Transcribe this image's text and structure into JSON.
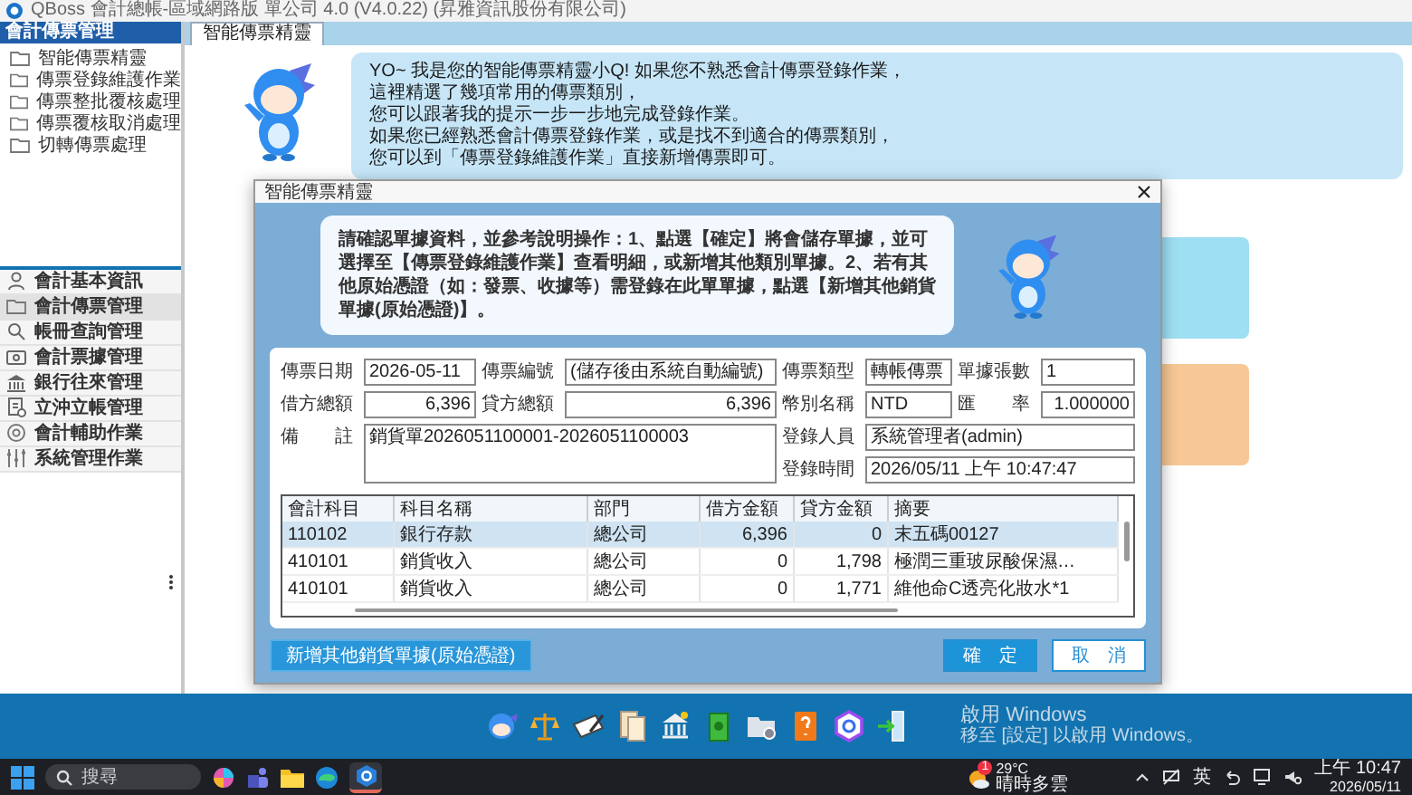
{
  "window": {
    "title": "QBoss 會計總帳-區域網路版 單公司 4.0 (V4.0.22) (昇雅資訊股份有限公司)"
  },
  "sidebar": {
    "title": "會計傳票管理",
    "items": [
      {
        "label": "智能傳票精靈"
      },
      {
        "label": "傳票登錄維護作業"
      },
      {
        "label": "傳票整批覆核處理"
      },
      {
        "label": "傳票覆核取消處理"
      },
      {
        "label": "切轉傳票處理"
      }
    ]
  },
  "modules": [
    {
      "label": "會計基本資訊",
      "selected": false
    },
    {
      "label": "會計傳票管理",
      "selected": true
    },
    {
      "label": "帳冊查詢管理",
      "selected": false
    },
    {
      "label": "會計票據管理",
      "selected": false
    },
    {
      "label": "銀行往來管理",
      "selected": false
    },
    {
      "label": "立沖立帳管理",
      "selected": false
    },
    {
      "label": "會計輔助作業",
      "selected": false
    },
    {
      "label": "系統管理作業",
      "selected": false
    }
  ],
  "tabs": [
    {
      "label": "智能傳票精靈",
      "selected": true
    }
  ],
  "welcome": {
    "lines": [
      "YO~ 我是您的智能傳票精靈小Q! 如果您不熟悉會計傳票登錄作業，",
      "這裡精選了幾項常用的傳票類別，",
      "您可以跟著我的提示一步一步地完成登錄作業。",
      "如果您已經熟悉會計傳票登錄作業，或是找不到適合的傳票類別，",
      "您可以到「傳票登錄維護作業」直接新增傳票即可。"
    ]
  },
  "dialog": {
    "title": "智能傳票精靈",
    "instructions": "請確認單據資料，並參考說明操作：1、點選【確定】將會儲存單據，並可選擇至【傳票登錄維護作業】查看明細，或新增其他類別單據。2、若有其他原始憑證（如：發票、收據等）需登錄在此單單據，點選【新增其他銷貨單據(原始憑證)】。",
    "fields": [
      {
        "label": "傳票日期",
        "value": "2026-05-11",
        "kind": "text"
      },
      {
        "label": "傳票編號",
        "value": "(儲存後由系統自動編號)",
        "kind": "text"
      },
      {
        "label": "傳票類型",
        "value": "轉帳傳票",
        "kind": "text"
      },
      {
        "label": "單據張數",
        "value": "1",
        "kind": "text"
      },
      {
        "label": "借方總額",
        "value": "6,396",
        "kind": "amount"
      },
      {
        "label": "貸方總額",
        "value": "6,396",
        "kind": "amount"
      },
      {
        "label": "幣別名稱",
        "value": "NTD",
        "kind": "text"
      },
      {
        "label": "匯　　率",
        "value": "1.000000",
        "kind": "amount"
      },
      {
        "label": "備　　註",
        "value": "銷貨單2026051100001-2026051100003",
        "kind": "text"
      },
      {
        "label": "登錄人員",
        "value": "系統管理者(admin)",
        "kind": "text"
      },
      {
        "label": "登錄時間",
        "value": "2026/05/11 上午 10:47:47",
        "kind": "text"
      }
    ],
    "grid": {
      "columns": [
        {
          "label": "會計科目",
          "kind": "text"
        },
        {
          "label": "科目名稱",
          "kind": "text"
        },
        {
          "label": "部門",
          "kind": "text"
        },
        {
          "label": "借方金額",
          "kind": "number"
        },
        {
          "label": "貸方金額",
          "kind": "number"
        },
        {
          "label": "摘要",
          "kind": "text"
        }
      ],
      "rows": [
        {
          "cells": [
            "110102",
            "銀行存款",
            "總公司",
            "6,396",
            "0",
            "末五碼00127"
          ],
          "selected": true
        },
        {
          "cells": [
            "410101",
            "銷貨收入",
            "總公司",
            "0",
            "1,798",
            "極潤三重玻尿酸保濕…"
          ],
          "selected": false
        },
        {
          "cells": [
            "410101",
            "銷貨收入",
            "總公司",
            "0",
            "1,771",
            "維他命C透亮化妝水*1"
          ],
          "selected": false
        }
      ]
    },
    "buttons": [
      {
        "label": "新增其他銷貨單據(原始憑證)",
        "kind": "secondary"
      },
      {
        "label": "確　定",
        "kind": "primary"
      },
      {
        "label": "取　消",
        "kind": "cancel"
      }
    ]
  },
  "activation": {
    "title": "啟用 Windows",
    "hint": "移至 [設定] 以啟用 Windows。"
  },
  "taskbar": {
    "search": {
      "placeholder": "搜尋"
    },
    "weather": {
      "temperature": "29°C",
      "condition": "晴時多雲",
      "badge": "1"
    },
    "language": "英",
    "time": "上午 10:47",
    "date": "2026/05/11"
  }
}
